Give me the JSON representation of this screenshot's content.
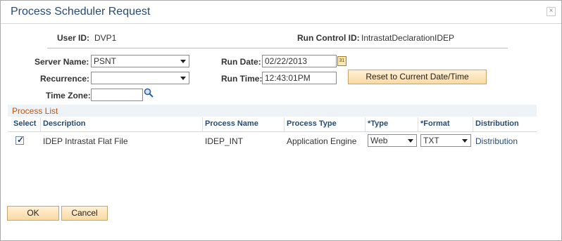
{
  "dialog": {
    "title": "Process Scheduler Request",
    "close_glyph": "×"
  },
  "header": {
    "user_id_label": "User ID:",
    "user_id_value": "DVP1",
    "run_control_label": "Run Control ID:",
    "run_control_value": "IntrastatDeclarationIDEP"
  },
  "form": {
    "server_name_label": "Server Name:",
    "server_name_value": "PSNT",
    "recurrence_label": "Recurrence:",
    "recurrence_value": "",
    "time_zone_label": "Time Zone:",
    "time_zone_value": "",
    "run_date_label": "Run Date:",
    "run_date_value": "02/22/2013",
    "run_time_label": "Run Time:",
    "run_time_value": "12:43:01PM",
    "reset_button": "Reset to Current Date/Time",
    "calendar_glyph": "31"
  },
  "process_list": {
    "title": "Process List",
    "columns": {
      "select": "Select",
      "description": "Description",
      "process_name": "Process Name",
      "process_type": "Process Type",
      "type": "*Type",
      "format": "*Format",
      "distribution": "Distribution"
    },
    "rows": [
      {
        "selected": true,
        "check_glyph": "✓",
        "description": "IDEP Intrastat Flat File",
        "process_name": "IDEP_INT",
        "process_type": "Application Engine",
        "type": "Web",
        "format": "TXT",
        "distribution": "Distribution"
      }
    ]
  },
  "footer": {
    "ok_button": "OK",
    "cancel_button": "Cancel"
  },
  "icons": {
    "calendar": "calendar-icon",
    "lookup": "magnifier-icon",
    "close": "close-icon",
    "dropdown": "chevron-down-icon"
  },
  "colors": {
    "title": "#274b73",
    "section_title": "#b05a1b",
    "button_fill": "#fbd9a2",
    "header_text": "#274b73"
  }
}
